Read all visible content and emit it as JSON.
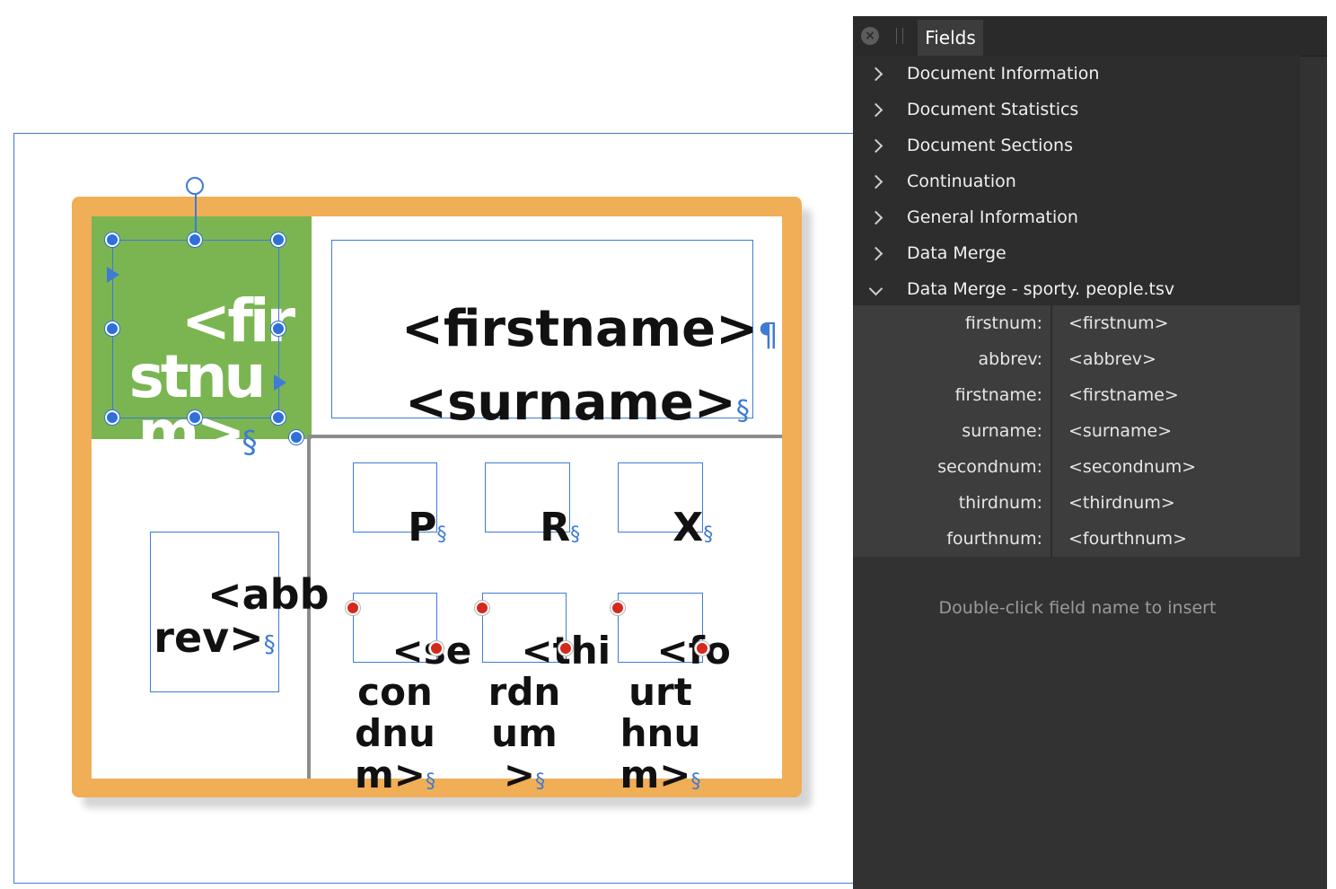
{
  "canvas": {
    "top_text_frame": {
      "line1": "<firstname>",
      "line2": "<surname>",
      "pilcrow": "¶"
    },
    "green_frame": {
      "text": "<fir\nstnu\nm>"
    },
    "abbrev_frame": {
      "text": "<abb\nrev>"
    },
    "letter_frames": [
      {
        "text": "P"
      },
      {
        "text": "R"
      },
      {
        "text": "X"
      }
    ],
    "overflow_frames": [
      {
        "text": "<se\ncon\ndnu\nm>"
      },
      {
        "text": "<thi\nrdn\num\n>"
      },
      {
        "text": "<fo\nurt\nhnu\nm>"
      }
    ],
    "section_mark": "§"
  },
  "panel": {
    "close_icon": "×",
    "tab_label": "Fields",
    "categories": [
      {
        "label": "Document Information",
        "expanded": false
      },
      {
        "label": "Document Statistics",
        "expanded": false
      },
      {
        "label": "Document Sections",
        "expanded": false
      },
      {
        "label": "Continuation",
        "expanded": false
      },
      {
        "label": "General Information",
        "expanded": false
      },
      {
        "label": "Data Merge",
        "expanded": false
      },
      {
        "label": "Data Merge - sporty. people.tsv",
        "expanded": true
      }
    ],
    "merge_fields": [
      {
        "name": "firstnum:",
        "value": "<firstnum>"
      },
      {
        "name": "abbrev:",
        "value": "<abbrev>"
      },
      {
        "name": "firstname:",
        "value": "<firstname>"
      },
      {
        "name": "surname:",
        "value": "<surname>"
      },
      {
        "name": "secondnum:",
        "value": "<secondnum>"
      },
      {
        "name": "thirdnum:",
        "value": "<thirdnum>"
      },
      {
        "name": "fourthnum:",
        "value": "<fourthnum>"
      }
    ],
    "hint": "Double-click field name to insert"
  },
  "colors": {
    "accent": "#3e7bd6",
    "card_orange": "#f0ae56",
    "card_green": "#7ab552",
    "panel_bg": "#323232"
  }
}
